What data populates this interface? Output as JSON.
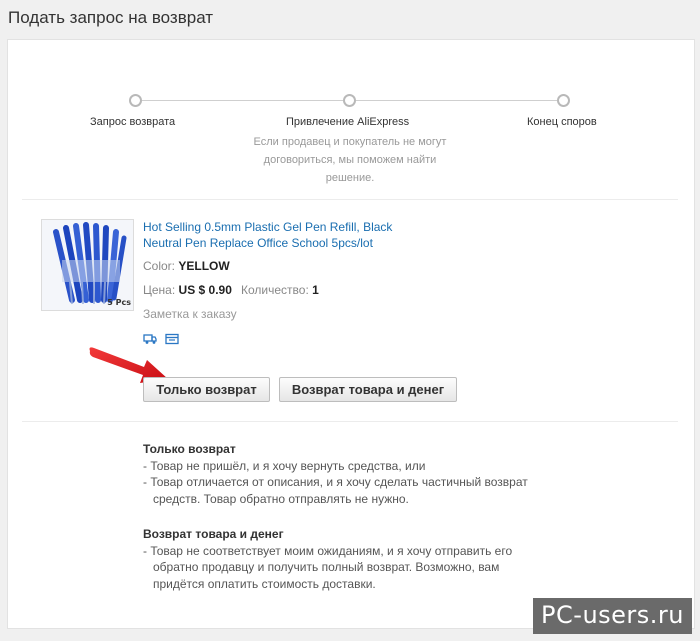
{
  "page_title": "Подать запрос на возврат",
  "steps": [
    {
      "label": "Запрос возврата"
    },
    {
      "label": "Привлечение AliExpress",
      "description": "Если продавец и покупатель не могут договориться, мы поможем найти решение."
    },
    {
      "label": "Конец споров"
    }
  ],
  "product": {
    "title": "Hot Selling 0.5mm Plastic Gel Pen Refill, Black Neutral Pen Replace Office School 5pcs/lot",
    "color_label": "Color:",
    "color_value": "YELLOW",
    "price_label": "Цена:",
    "price_value": "US $ 0.90",
    "qty_label": "Количество:",
    "qty_value": "1",
    "note": "Заметка к заказу",
    "thumb_caption": "5 Pcs"
  },
  "buttons": {
    "refund_only": "Только возврат",
    "return_and_refund": "Возврат товара и денег"
  },
  "info": {
    "refund_only": {
      "title": "Только возврат",
      "items": [
        "- Товар не пришёл, и я хочу вернуть средства, или",
        "- Товар отличается от описания, и я хочу сделать частичный возврат средств. Товар обратно отправлять не нужно."
      ]
    },
    "return_and_refund": {
      "title": "Возврат товара и денег",
      "items": [
        "- Товар не соответствует моим ожиданиям, и я хочу отправить его обратно продавцу и получить полный возврат. Возможно, вам придётся оплатить стоимость доставки."
      ]
    }
  },
  "watermark": "PC-users.ru",
  "colors": {
    "link": "#1a6eb0",
    "arrow": "#e3141b",
    "muted": "#999999"
  }
}
